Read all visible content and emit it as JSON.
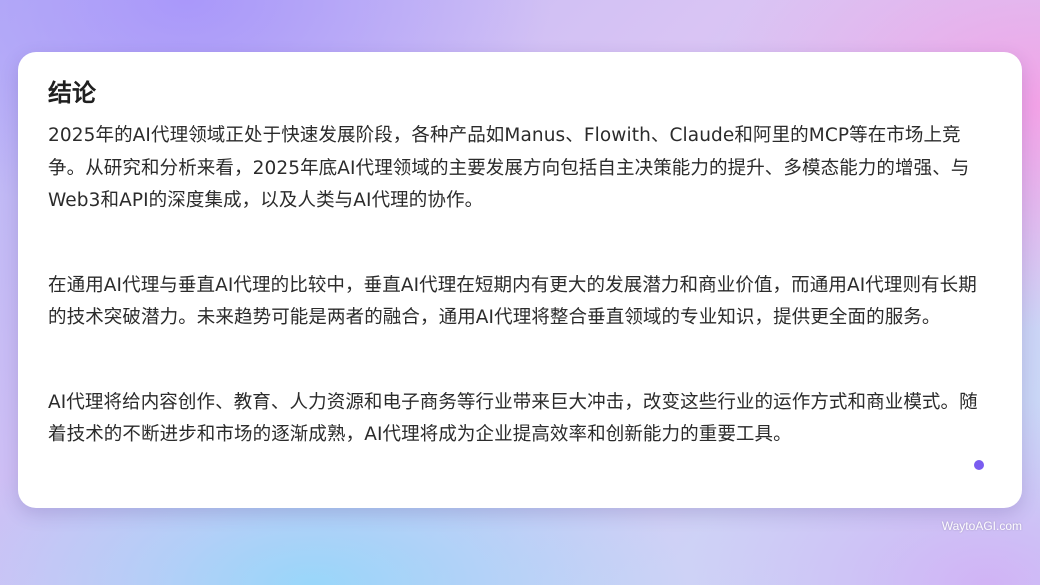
{
  "card": {
    "title": "结论",
    "paragraphs": [
      "2025年的AI代理领域正处于快速发展阶段，各种产品如Manus、Flowith、Claude和阿里的MCP等在市场上竞争。从研究和分析来看，2025年底AI代理领域的主要发展方向包括自主决策能力的提升、多模态能力的增强、与Web3和API的深度集成，以及人类与AI代理的协作。",
      "在通用AI代理与垂直AI代理的比较中，垂直AI代理在短期内有更大的发展潜力和商业价值，而通用AI代理则有长期的技术突破潜力。未来趋势可能是两者的融合，通用AI代理将整合垂直领域的专业知识，提供更全面的服务。",
      "AI代理将给内容创作、教育、人力资源和电子商务等行业带来巨大冲击，改变这些行业的运作方式和商业模式。随着技术的不断进步和市场的逐渐成熟，AI代理将成为企业提高效率和创新能力的重要工具。"
    ],
    "accent_dot_color": "#7a5cf0"
  },
  "watermark": "WaytoAGI.com"
}
